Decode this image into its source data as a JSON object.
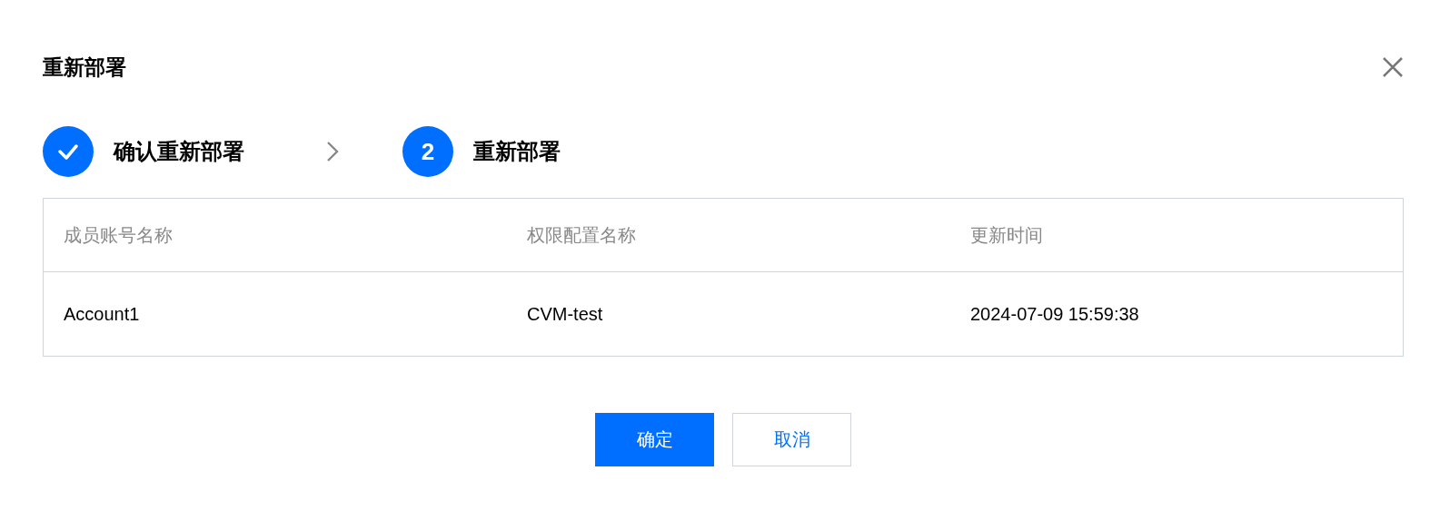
{
  "dialog": {
    "title": "重新部署",
    "steps": [
      {
        "label": "确认重新部署",
        "completed": true
      },
      {
        "label": "重新部署",
        "number": "2",
        "completed": false
      }
    ],
    "table": {
      "columns": [
        "成员账号名称",
        "权限配置名称",
        "更新时间"
      ],
      "rows": [
        [
          "Account1",
          "CVM-test",
          "2024-07-09 15:59:38"
        ]
      ]
    },
    "buttons": [
      {
        "label": "确定",
        "kind": "primary"
      },
      {
        "label": "取消",
        "kind": "secondary"
      }
    ]
  }
}
